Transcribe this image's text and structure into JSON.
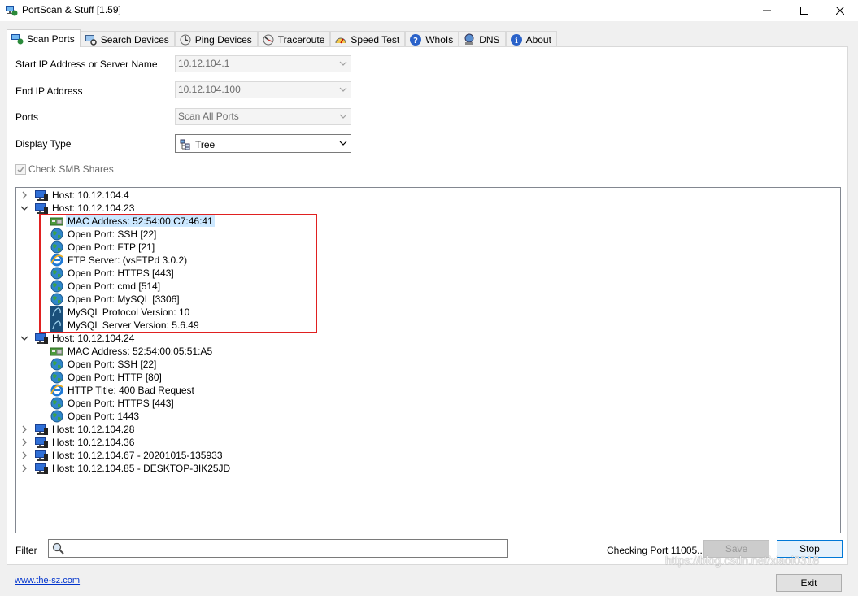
{
  "window": {
    "title": "PortScan & Stuff [1.59]",
    "minimize": "—",
    "maximize": "☐",
    "close": "✕"
  },
  "tabs": [
    {
      "label": "Scan Ports",
      "icon": "scan-ports-icon",
      "active": true
    },
    {
      "label": "Search Devices",
      "icon": "search-devices-icon"
    },
    {
      "label": "Ping Devices",
      "icon": "ping-icon"
    },
    {
      "label": "Traceroute",
      "icon": "traceroute-icon"
    },
    {
      "label": "Speed Test",
      "icon": "speedometer-icon"
    },
    {
      "label": "WhoIs",
      "icon": "help-circle-icon"
    },
    {
      "label": "DNS",
      "icon": "dns-icon"
    },
    {
      "label": "About",
      "icon": "info-icon"
    }
  ],
  "form": {
    "start_ip_label": "Start IP Address or Server Name",
    "start_ip_value": "10.12.104.1",
    "end_ip_label": "End IP Address",
    "end_ip_value": "10.12.104.100",
    "ports_label": "Ports",
    "ports_value": "Scan All Ports",
    "display_type_label": "Display Type",
    "display_type_value": "Tree",
    "check_smb_label": "Check SMB Shares",
    "check_smb_checked": true
  },
  "tree": [
    {
      "level": 0,
      "expand": "collapsed",
      "icon": "host-icon",
      "label": "Host: 10.12.104.4"
    },
    {
      "level": 0,
      "expand": "expanded",
      "icon": "host-icon",
      "label": "Host: 10.12.104.23"
    },
    {
      "level": 1,
      "icon": "network-card-icon",
      "label": "MAC Address: 52:54:00:C7:46:41",
      "selected": true
    },
    {
      "level": 1,
      "icon": "globe-icon",
      "label": "Open Port: SSH [22]"
    },
    {
      "level": 1,
      "icon": "globe-icon",
      "label": "Open Port: FTP [21]"
    },
    {
      "level": 1,
      "icon": "ie-icon",
      "label": "FTP Server: (vsFTPd 3.0.2)"
    },
    {
      "level": 1,
      "icon": "globe-icon",
      "label": "Open Port: HTTPS [443]"
    },
    {
      "level": 1,
      "icon": "globe-icon",
      "label": "Open Port: cmd [514]"
    },
    {
      "level": 1,
      "icon": "globe-icon",
      "label": "Open Port: MySQL [3306]"
    },
    {
      "level": 1,
      "icon": "mysql-icon",
      "label": "MySQL Protocol Version: 10"
    },
    {
      "level": 1,
      "icon": "mysql-icon",
      "label": "MySQL Server Version: 5.6.49"
    },
    {
      "level": 0,
      "expand": "expanded",
      "icon": "host-icon",
      "label": "Host: 10.12.104.24"
    },
    {
      "level": 1,
      "icon": "network-card-icon",
      "label": "MAC Address: 52:54:00:05:51:A5"
    },
    {
      "level": 1,
      "icon": "globe-icon",
      "label": "Open Port: SSH [22]"
    },
    {
      "level": 1,
      "icon": "globe-icon",
      "label": "Open Port: HTTP [80]"
    },
    {
      "level": 1,
      "icon": "ie-icon",
      "label": "HTTP Title: 400 Bad Request"
    },
    {
      "level": 1,
      "icon": "globe-icon",
      "label": "Open Port: HTTPS [443]"
    },
    {
      "level": 1,
      "icon": "globe-icon",
      "label": "Open Port: 1443"
    },
    {
      "level": 0,
      "expand": "collapsed",
      "icon": "host-icon",
      "label": "Host: 10.12.104.28"
    },
    {
      "level": 0,
      "expand": "collapsed",
      "icon": "host-icon",
      "label": "Host: 10.12.104.36"
    },
    {
      "level": 0,
      "expand": "collapsed",
      "icon": "host-icon",
      "label": "Host: 10.12.104.67 - 20201015-135933"
    },
    {
      "level": 0,
      "expand": "collapsed",
      "icon": "host-icon",
      "label": "Host: 10.12.104.85 - DESKTOP-3IK25JD"
    }
  ],
  "bottom": {
    "filter_label": "Filter",
    "filter_value": "",
    "status": "Checking Port 11005...",
    "save_label": "Save",
    "stop_label": "Stop",
    "link": "www.the-sz.com",
    "exit_label": "Exit",
    "watermark": "https://blog.csdn.net/xiaoi0318"
  },
  "colors": {
    "highlight_box": "#e02020",
    "selection": "#cce8ff",
    "link": "#0033cc"
  }
}
